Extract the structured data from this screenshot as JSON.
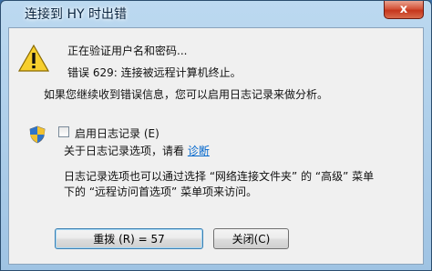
{
  "window": {
    "title": "连接到 HY 时出错",
    "close_label": "x"
  },
  "message": {
    "line1": "正在验证用户名和密码...",
    "line2": "错误 629: 连接被远程计算机终止。",
    "line3": "如果您继续收到错误信息，您可以启用日志记录来做分析。"
  },
  "logging": {
    "checkbox_label": "启用日志记录 (E)",
    "about_text": "关于日志记录选项，请看",
    "link_text": "诊断",
    "checked": false
  },
  "info": {
    "line1": "日志记录选项也可以通过选择 “网络连接文件夹” 的 “高级” 菜单",
    "line2": "下的 “远程访问首选项” 菜单项来访问。"
  },
  "buttons": {
    "redial_label": "重拨 (R) = 57",
    "close_label": "关闭(C)"
  },
  "icons": {
    "warning": "warning-icon",
    "shield": "uac-shield-icon"
  }
}
